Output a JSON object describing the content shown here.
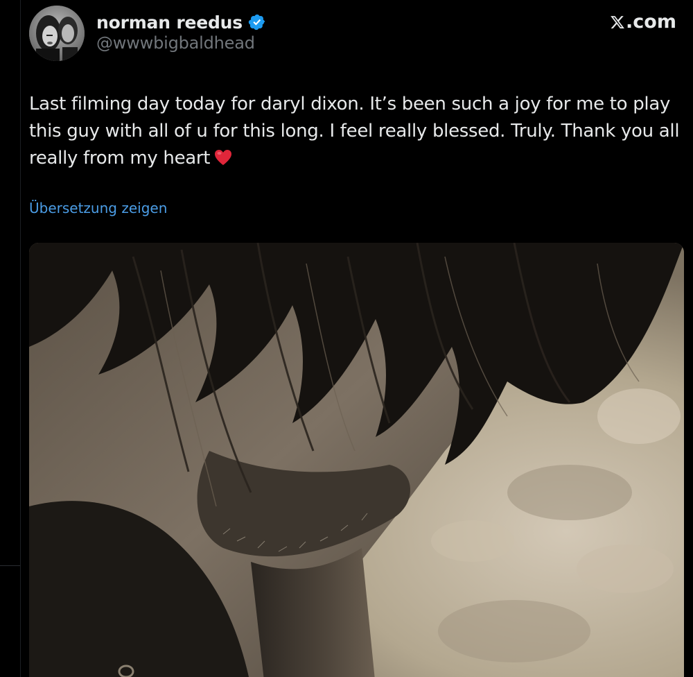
{
  "author": {
    "display_name": "norman reedus",
    "handle": "@wwwbigbaldhead",
    "verified": true,
    "verified_color": "#1d9bf0"
  },
  "brand": {
    "label": ".com"
  },
  "tweet": {
    "text": "Last filming day today for daryl dixon. It’s been such a joy for me to play this guy with all of u for this long. I feel really blessed. Truly. Thank you all really from my heart",
    "emoji": "heart-icon"
  },
  "translate": {
    "label": "Übersetzung zeigen",
    "color": "#4b9de6"
  },
  "theme": {
    "background": "#000000",
    "text": "#e7e9ea",
    "muted": "#71767b"
  }
}
